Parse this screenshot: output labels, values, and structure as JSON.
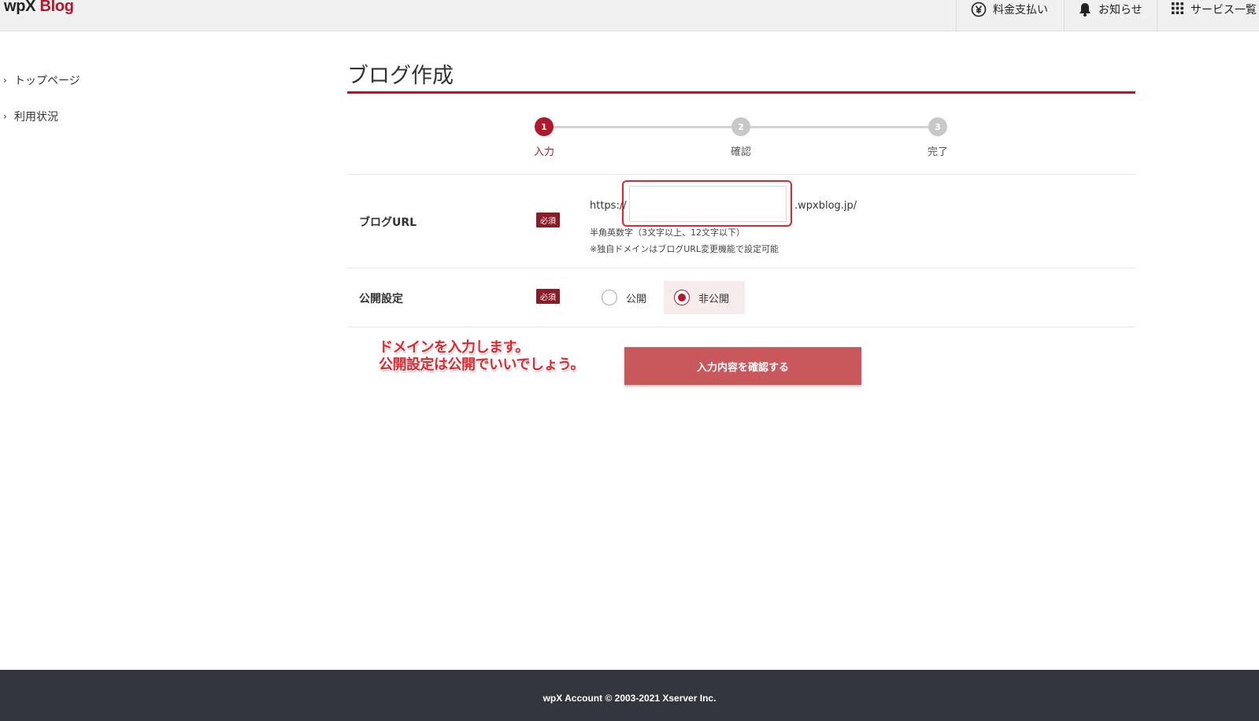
{
  "header": {
    "logo_part1": "wpX",
    "logo_part2": "Blog",
    "nav": [
      {
        "label": "料金支払い",
        "icon": "yen-icon"
      },
      {
        "label": "お知らせ",
        "icon": "bell-icon"
      },
      {
        "label": "サービス一覧",
        "icon": "grid-icon"
      }
    ]
  },
  "sidebar": {
    "items": [
      {
        "label": "トップページ"
      },
      {
        "label": "利用状況"
      }
    ]
  },
  "main": {
    "title": "ブログ作成",
    "steps": [
      {
        "number": "1",
        "label": "入力",
        "active": true
      },
      {
        "number": "2",
        "label": "確認",
        "active": false
      },
      {
        "number": "3",
        "label": "完了",
        "active": false
      }
    ],
    "url_row": {
      "label": "ブログURL",
      "required": "必須",
      "prefix": "https://",
      "suffix": ".wpxblog.jp/",
      "value": "",
      "help1": "半角英数字（3文字以上、12文字以下）",
      "help2": "※独自ドメインはブログURL変更機能で設定可能"
    },
    "visibility_row": {
      "label": "公開設定",
      "required": "必須",
      "options": [
        {
          "label": "公開",
          "checked": false
        },
        {
          "label": "非公開",
          "checked": true
        }
      ]
    },
    "annotation_line1": "ドメインを入力します。",
    "annotation_line2": "公開設定は公開でいいでしょう。",
    "confirm_button": "入力内容を確認する"
  },
  "footer": {
    "copyright": "wpX Account © 2003-2021 Xserver Inc."
  },
  "colors": {
    "brand_red": "#b5172a",
    "button": "#c9585c",
    "footer_bg": "#33363d"
  }
}
